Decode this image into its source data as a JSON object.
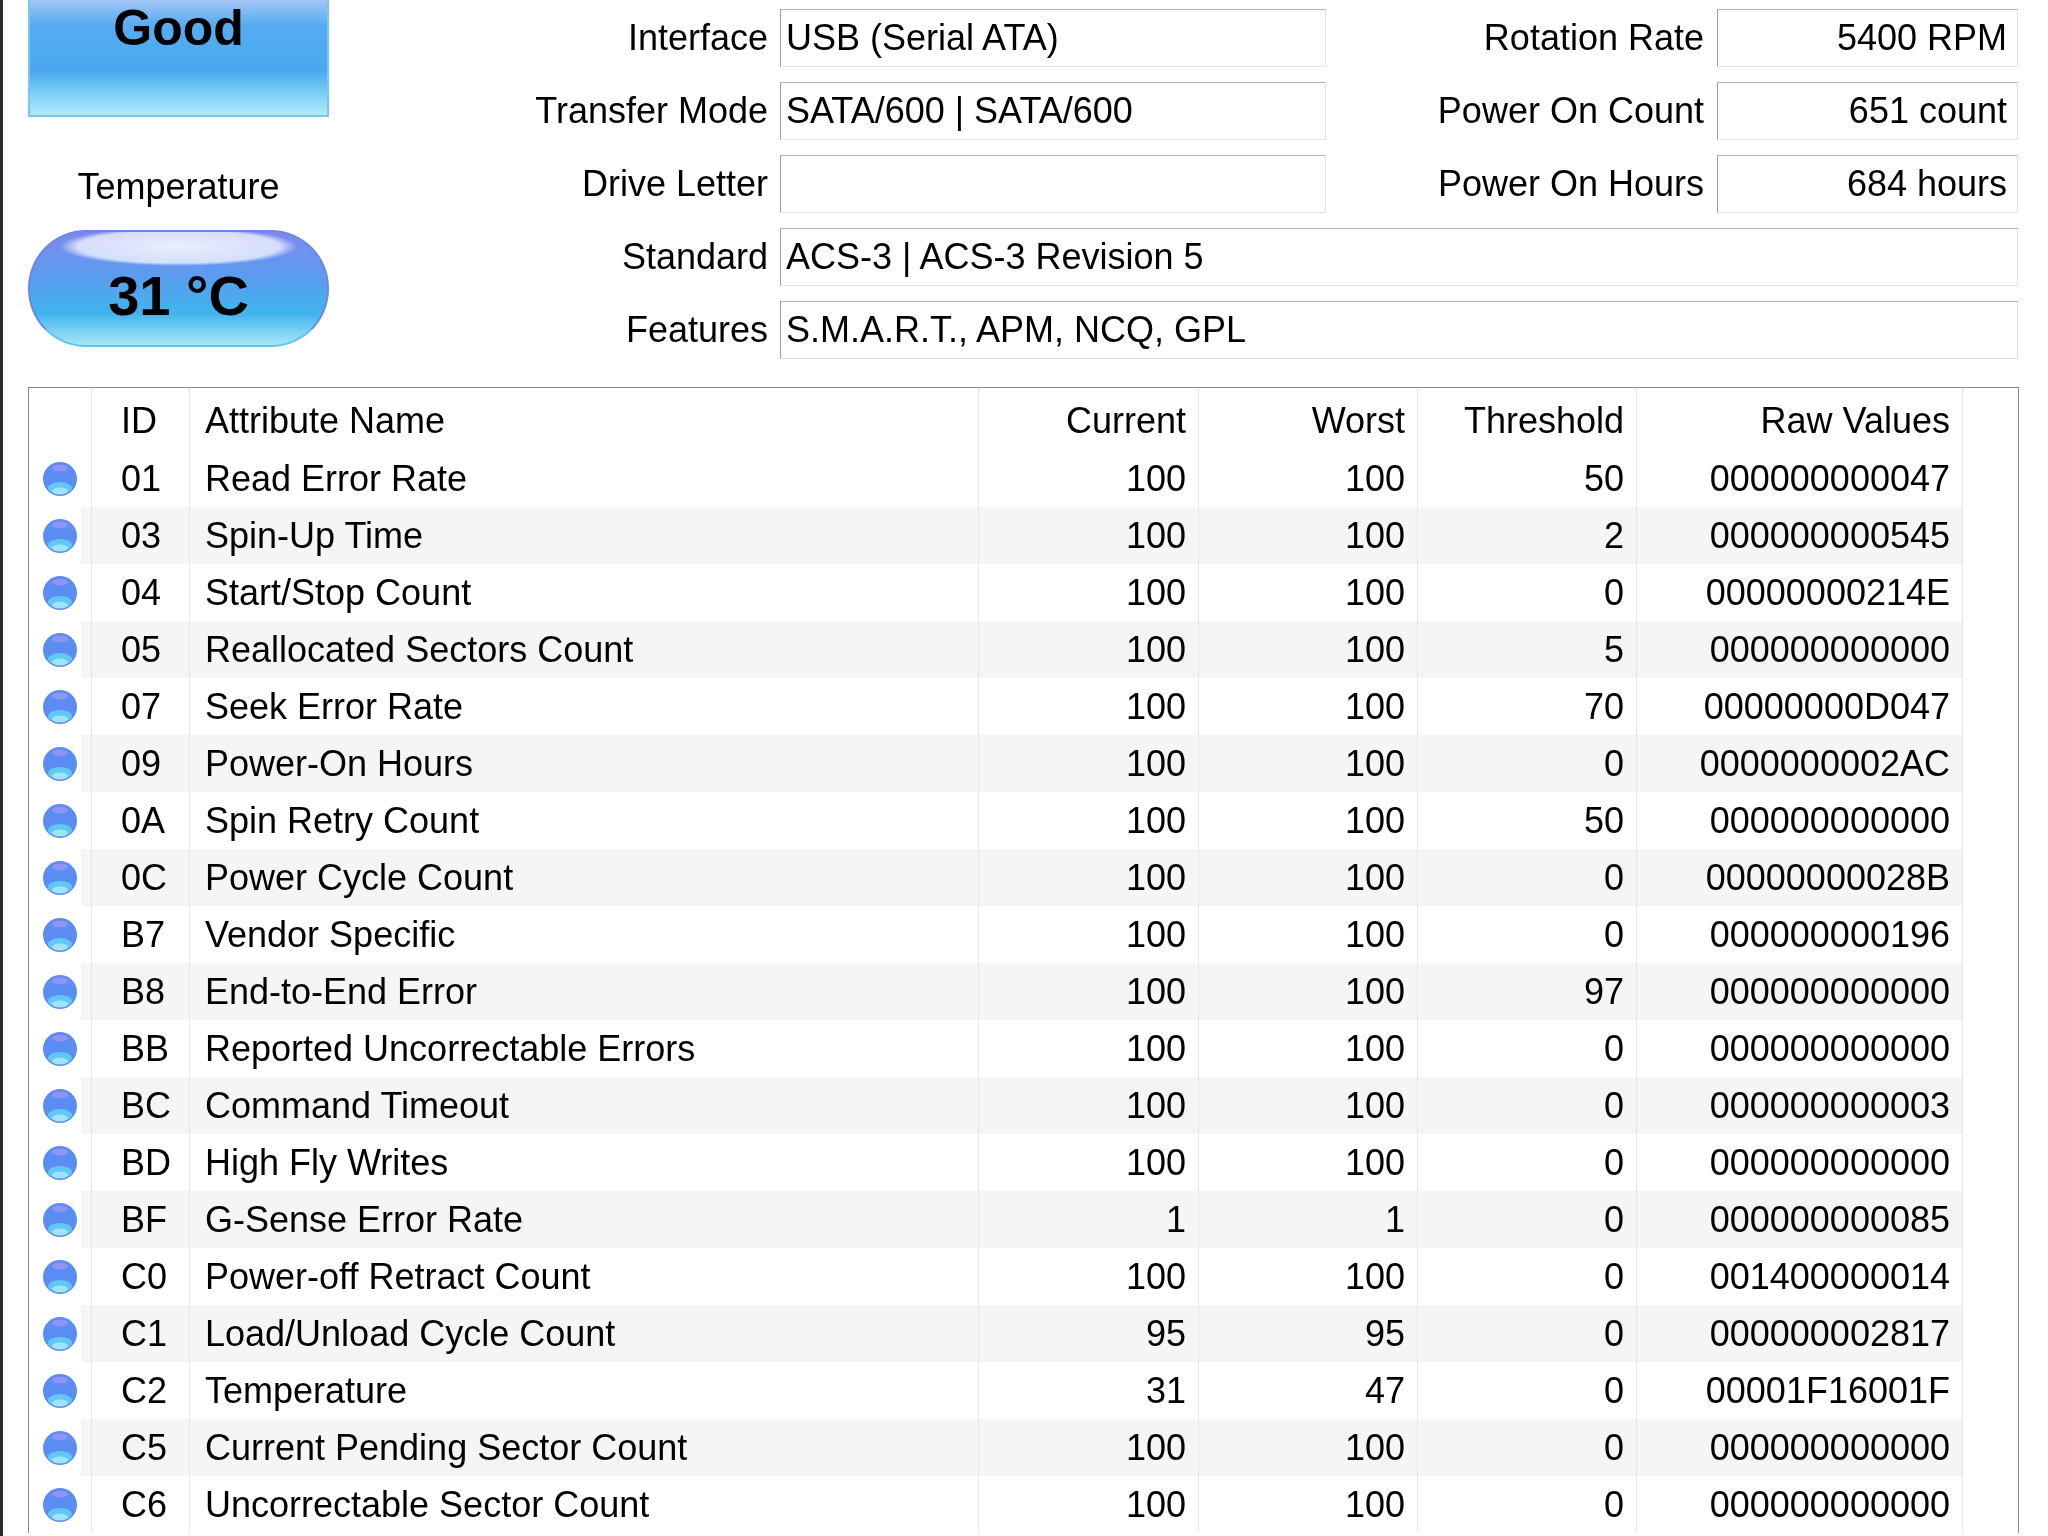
{
  "health": {
    "status": "Good"
  },
  "temperature": {
    "label": "Temperature",
    "reading": "31 °C"
  },
  "info_rows": [
    [
      {
        "label": "Interface",
        "value": "USB (Serial ATA)"
      },
      {
        "label": "Rotation Rate",
        "value": "5400 RPM"
      }
    ],
    [
      {
        "label": "Transfer Mode",
        "value": "SATA/600 | SATA/600"
      },
      {
        "label": "Power On Count",
        "value": "651 count"
      }
    ],
    [
      {
        "label": "Drive Letter"
      },
      {
        "label": "Power On Hours",
        "value": "684 hours"
      }
    ],
    [
      {
        "label": "Standard",
        "value": "ACS-3 | ACS-3 Revision 5"
      }
    ],
    [
      {
        "label": "Features",
        "value": "S.M.A.R.T., APM, NCQ, GPL"
      }
    ]
  ],
  "smart_table": {
    "columns": [
      "ID",
      "Attribute Name",
      "Current",
      "Worst",
      "Threshold",
      "Raw Values"
    ],
    "rows": [
      {
        "color": "#5a8cf2",
        "id": "01",
        "name": "Read Error Rate",
        "current": "100",
        "worst": "100",
        "threshold": "50",
        "raw": "000000000047"
      },
      {
        "color": "#5a8cf2",
        "id": "03",
        "name": "Spin-Up Time",
        "current": "100",
        "worst": "100",
        "threshold": "2",
        "raw": "000000000545"
      },
      {
        "color": "#5a8cf2",
        "id": "04",
        "name": "Start/Stop Count",
        "current": "100",
        "worst": "100",
        "threshold": "0",
        "raw": "00000000214E"
      },
      {
        "color": "#5a8cf2",
        "id": "05",
        "name": "Reallocated Sectors Count",
        "current": "100",
        "worst": "100",
        "threshold": "5",
        "raw": "000000000000"
      },
      {
        "color": "#5a8cf2",
        "id": "07",
        "name": "Seek Error Rate",
        "current": "100",
        "worst": "100",
        "threshold": "70",
        "raw": "00000000D047"
      },
      {
        "color": "#5a8cf2",
        "id": "09",
        "name": "Power-On Hours",
        "current": "100",
        "worst": "100",
        "threshold": "0",
        "raw": "0000000002AC"
      },
      {
        "color": "#5a8cf2",
        "id": "0A",
        "name": "Spin Retry Count",
        "current": "100",
        "worst": "100",
        "threshold": "50",
        "raw": "000000000000"
      },
      {
        "color": "#5a8cf2",
        "id": "0C",
        "name": "Power Cycle Count",
        "current": "100",
        "worst": "100",
        "threshold": "0",
        "raw": "00000000028B"
      },
      {
        "color": "#5a8cf2",
        "id": "B7",
        "name": "Vendor Specific",
        "current": "100",
        "worst": "100",
        "threshold": "0",
        "raw": "000000000196"
      },
      {
        "color": "#5a8cf2",
        "id": "B8",
        "name": "End-to-End Error",
        "current": "100",
        "worst": "100",
        "threshold": "97",
        "raw": "000000000000"
      },
      {
        "color": "#5a8cf2",
        "id": "BB",
        "name": "Reported Uncorrectable Errors",
        "current": "100",
        "worst": "100",
        "threshold": "0",
        "raw": "000000000000"
      },
      {
        "color": "#5a8cf2",
        "id": "BC",
        "name": "Command Timeout",
        "current": "100",
        "worst": "100",
        "threshold": "0",
        "raw": "000000000003"
      },
      {
        "color": "#5a8cf2",
        "id": "BD",
        "name": "High Fly Writes",
        "current": "100",
        "worst": "100",
        "threshold": "0",
        "raw": "000000000000"
      },
      {
        "color": "#5a8cf2",
        "id": "BF",
        "name": "G-Sense Error Rate",
        "current": "1",
        "worst": "1",
        "threshold": "0",
        "raw": "000000000085"
      },
      {
        "color": "#5a8cf2",
        "id": "C0",
        "name": "Power-off Retract Count",
        "current": "100",
        "worst": "100",
        "threshold": "0",
        "raw": "001400000014"
      },
      {
        "color": "#5a8cf2",
        "id": "C1",
        "name": "Load/Unload Cycle Count",
        "current": "95",
        "worst": "95",
        "threshold": "0",
        "raw": "000000002817"
      },
      {
        "color": "#5a8cf2",
        "id": "C2",
        "name": "Temperature",
        "current": "31",
        "worst": "47",
        "threshold": "0",
        "raw": "00001F16001F"
      },
      {
        "color": "#5a8cf2",
        "id": "C5",
        "name": "Current Pending Sector Count",
        "current": "100",
        "worst": "100",
        "threshold": "0",
        "raw": "000000000000"
      },
      {
        "color": "#5a8cf2",
        "id": "C6",
        "name": "Uncorrectable Sector Count",
        "current": "100",
        "worst": "100",
        "threshold": "0",
        "raw": "000000000000"
      }
    ]
  }
}
